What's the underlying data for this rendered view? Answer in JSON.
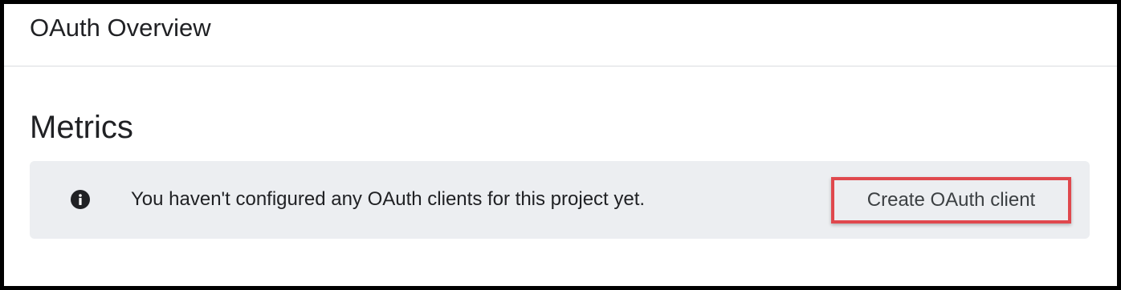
{
  "header": {
    "title": "OAuth Overview"
  },
  "metrics": {
    "title": "Metrics",
    "banner": {
      "icon": "info-icon",
      "message": "You haven't configured any OAuth clients for this project yet.",
      "action_label": "Create OAuth client"
    }
  },
  "colors": {
    "highlight": "#e0484d",
    "banner_bg": "#eceef1",
    "text": "#202124"
  }
}
